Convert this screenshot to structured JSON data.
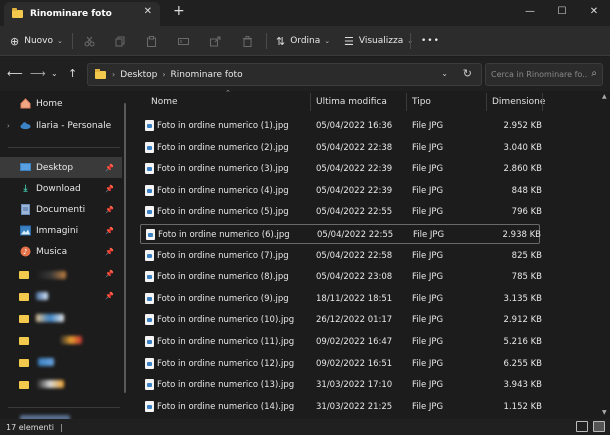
{
  "window": {
    "tab_title": "Rinominare foto",
    "close_glyph": "✕",
    "add_glyph": "+",
    "minimize_glyph": "—",
    "maximize_glyph": "☐",
    "window_close_glyph": "✕"
  },
  "toolbar": {
    "new_label": "Nuovo",
    "sort_label": "Ordina",
    "view_label": "Visualizza",
    "more_label": "•••",
    "icons": [
      "cut-icon",
      "copy-icon",
      "paste-icon",
      "rename-icon",
      "share-icon",
      "delete-icon"
    ]
  },
  "address": {
    "crumbs": [
      "Desktop",
      "Rinominare foto"
    ],
    "search_placeholder": "Cerca in Rinominare fo..."
  },
  "sidebar": {
    "items": [
      {
        "label": "Home",
        "icon": "home-icon"
      },
      {
        "label": "Ilaria - Personale",
        "icon": "cloud-icon"
      },
      {
        "label": "Desktop",
        "icon": "desktop-icon",
        "active": true
      },
      {
        "label": "Download",
        "icon": "download-icon"
      },
      {
        "label": "Documenti",
        "icon": "documents-icon"
      },
      {
        "label": "Immagini",
        "icon": "pictures-icon"
      },
      {
        "label": "Musica",
        "icon": "music-icon"
      }
    ]
  },
  "list": {
    "columns": [
      "Nome",
      "Ultima modifica",
      "Tipo",
      "Dimensione"
    ],
    "rows": [
      {
        "name": "Foto in ordine numerico (1).jpg",
        "modified": "05/04/2022 16:36",
        "type": "File JPG",
        "size": "2.952 KB"
      },
      {
        "name": "Foto in ordine numerico (2).jpg",
        "modified": "05/04/2022 22:38",
        "type": "File JPG",
        "size": "3.040 KB"
      },
      {
        "name": "Foto in ordine numerico (3).jpg",
        "modified": "05/04/2022 22:39",
        "type": "File JPG",
        "size": "2.860 KB"
      },
      {
        "name": "Foto in ordine numerico (4).jpg",
        "modified": "05/04/2022 22:39",
        "type": "File JPG",
        "size": "848 KB"
      },
      {
        "name": "Foto in ordine numerico (5).jpg",
        "modified": "05/04/2022 22:55",
        "type": "File JPG",
        "size": "796 KB"
      },
      {
        "name": "Foto in ordine numerico (6).jpg",
        "modified": "05/04/2022 22:55",
        "type": "File JPG",
        "size": "2.938 KB"
      },
      {
        "name": "Foto in ordine numerico (7).jpg",
        "modified": "05/04/2022 22:58",
        "type": "File JPG",
        "size": "825 KB"
      },
      {
        "name": "Foto in ordine numerico (8).jpg",
        "modified": "05/04/2022 23:08",
        "type": "File JPG",
        "size": "785 KB"
      },
      {
        "name": "Foto in ordine numerico (9).jpg",
        "modified": "18/11/2022 18:51",
        "type": "File JPG",
        "size": "3.135 KB"
      },
      {
        "name": "Foto in ordine numerico (10).jpg",
        "modified": "26/12/2022 01:17",
        "type": "File JPG",
        "size": "2.912 KB"
      },
      {
        "name": "Foto in ordine numerico (11).jpg",
        "modified": "09/02/2022 16:47",
        "type": "File JPG",
        "size": "5.216 KB"
      },
      {
        "name": "Foto in ordine numerico (12).jpg",
        "modified": "09/02/2022 16:51",
        "type": "File JPG",
        "size": "6.255 KB"
      },
      {
        "name": "Foto in ordine numerico (13).jpg",
        "modified": "31/03/2022 17:10",
        "type": "File JPG",
        "size": "3.943 KB"
      },
      {
        "name": "Foto in ordine numerico (14).jpg",
        "modified": "31/03/2022 21:25",
        "type": "File JPG",
        "size": "1.152 KB"
      }
    ]
  },
  "status": {
    "count": "17 elementi",
    "caret": "|"
  },
  "colors": {
    "background": "#1c1c1c",
    "folder": "#f2c94c",
    "accent": "#3b82c4"
  }
}
